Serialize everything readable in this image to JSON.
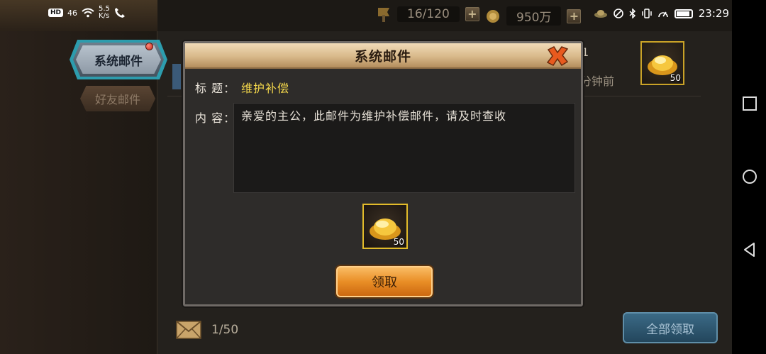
{
  "status": {
    "network": "HD",
    "signal": "46",
    "speed": "5.5\nK/s",
    "time": "23:29"
  },
  "resources": {
    "stamina": "16/120",
    "gold": "950万"
  },
  "tabs": {
    "system": "系统邮件",
    "friends": "好友邮件"
  },
  "background_item": {
    "count": "1",
    "time_suffix": "分钟前",
    "qty": "50"
  },
  "footer": {
    "mail_count": "1/50",
    "claim_all": "全部领取"
  },
  "modal": {
    "title": "系统邮件",
    "subject_label": "标 题：",
    "subject_value": "维护补偿",
    "content_label": "内 容：",
    "content_value": "亲爱的主公，此邮件为维护补偿邮件，请及时查收",
    "reward_qty": "50",
    "claim_label": "领取"
  },
  "colors": {
    "subject": "#f2d64b",
    "reward_border": "#e2bb2a",
    "claim_button": "#e98e26",
    "claim_all_button": "#2f5a74"
  }
}
